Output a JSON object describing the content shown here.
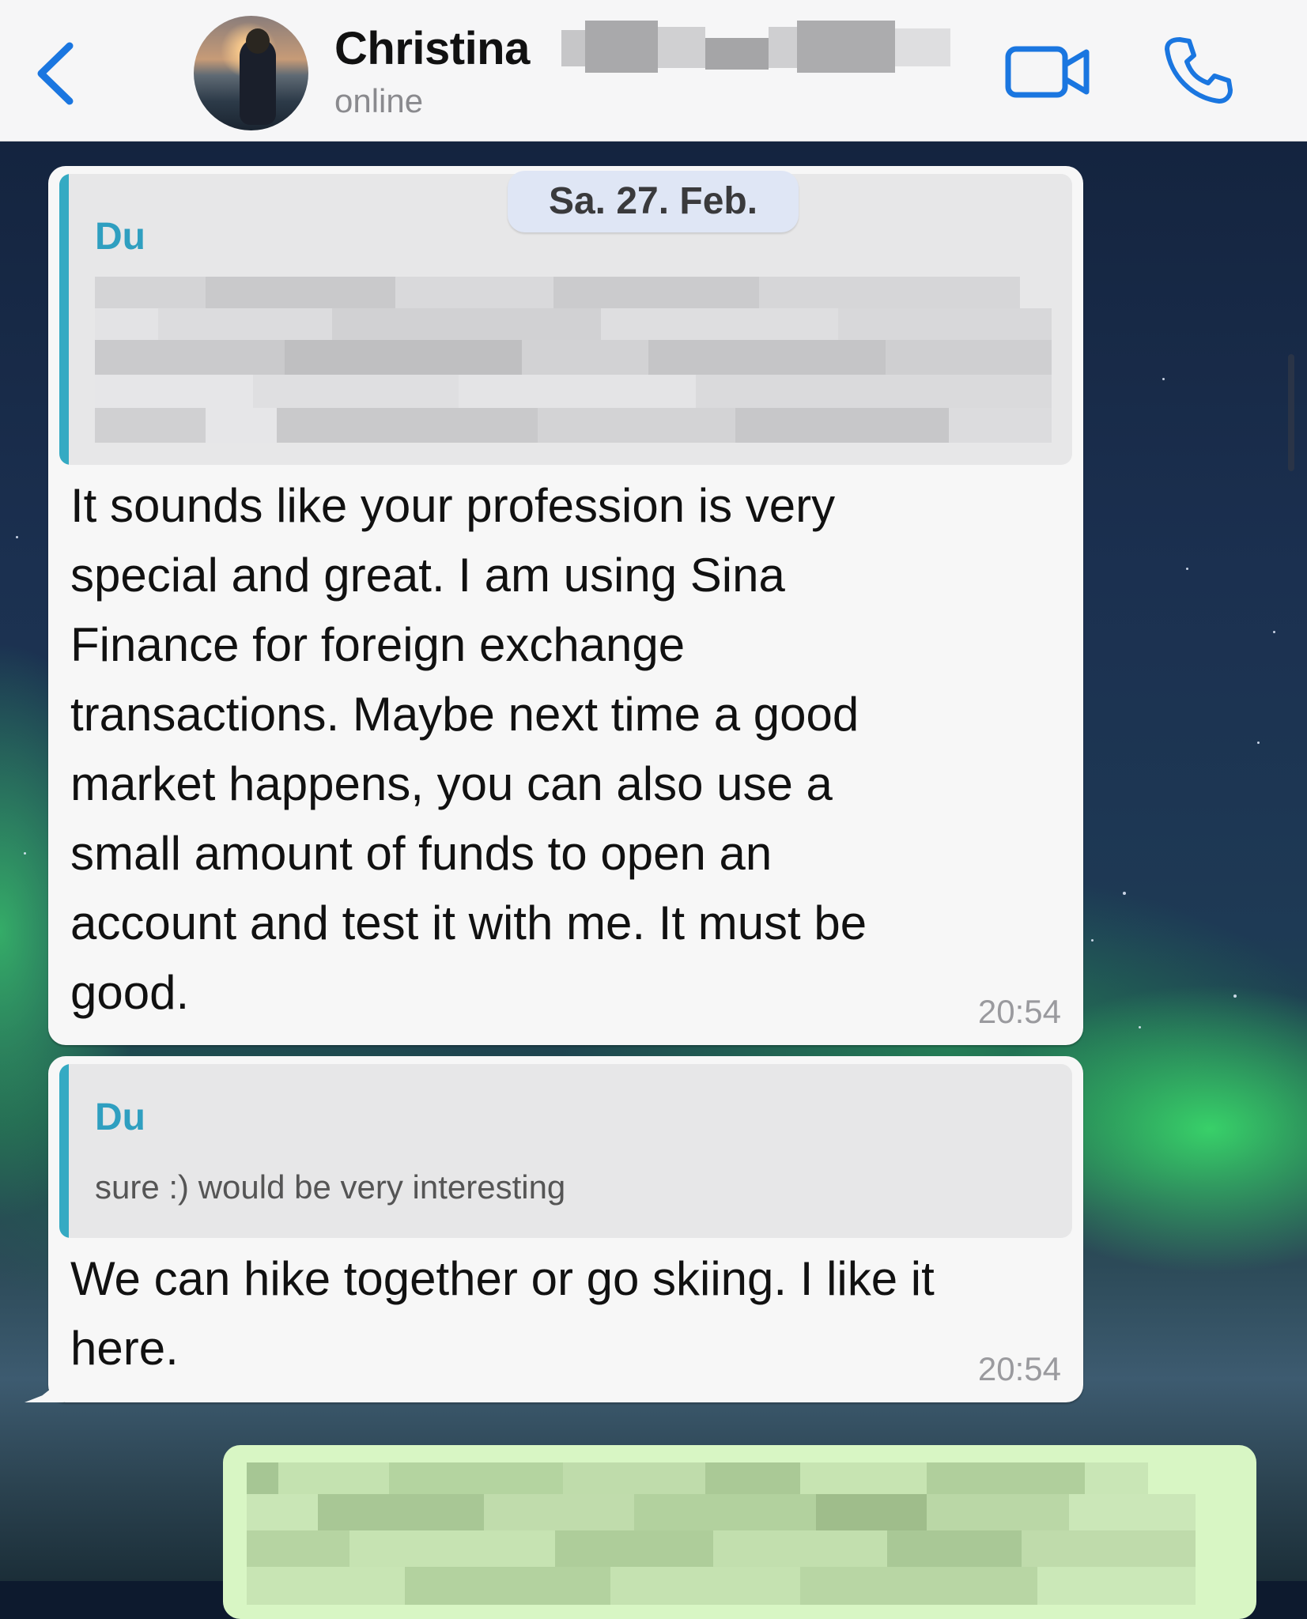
{
  "header": {
    "back_label": "",
    "contact_name": "Christina",
    "status": "online"
  },
  "chat": {
    "date_separator": "Sa. 27. Feb.",
    "messages": [
      {
        "direction": "incoming",
        "quoted_author": "Du",
        "quoted_text_redacted": true,
        "text": "It sounds like your profession is very\nspecial and great. I am using Sina\nFinance for foreign exchange\ntransactions. Maybe next time a good\nmarket happens, you can also use a\nsmall amount of funds to open an\naccount and test it with me. It must be\ngood.",
        "time": "20:54"
      },
      {
        "direction": "incoming",
        "quoted_author": "Du",
        "quoted_text": "sure :) would be very interesting",
        "text": "We can hike together or go skiing. I like it\nhere.",
        "time": "20:54"
      },
      {
        "direction": "outgoing",
        "text_redacted": true
      }
    ]
  },
  "colors": {
    "accent_blue": "#1a76e0",
    "quote_author": "#2f9fc0",
    "outgoing_bubble": "#d8f6c4"
  },
  "icons": {
    "back": "chevron-left-icon",
    "video": "video-camera-icon",
    "call": "phone-icon"
  }
}
